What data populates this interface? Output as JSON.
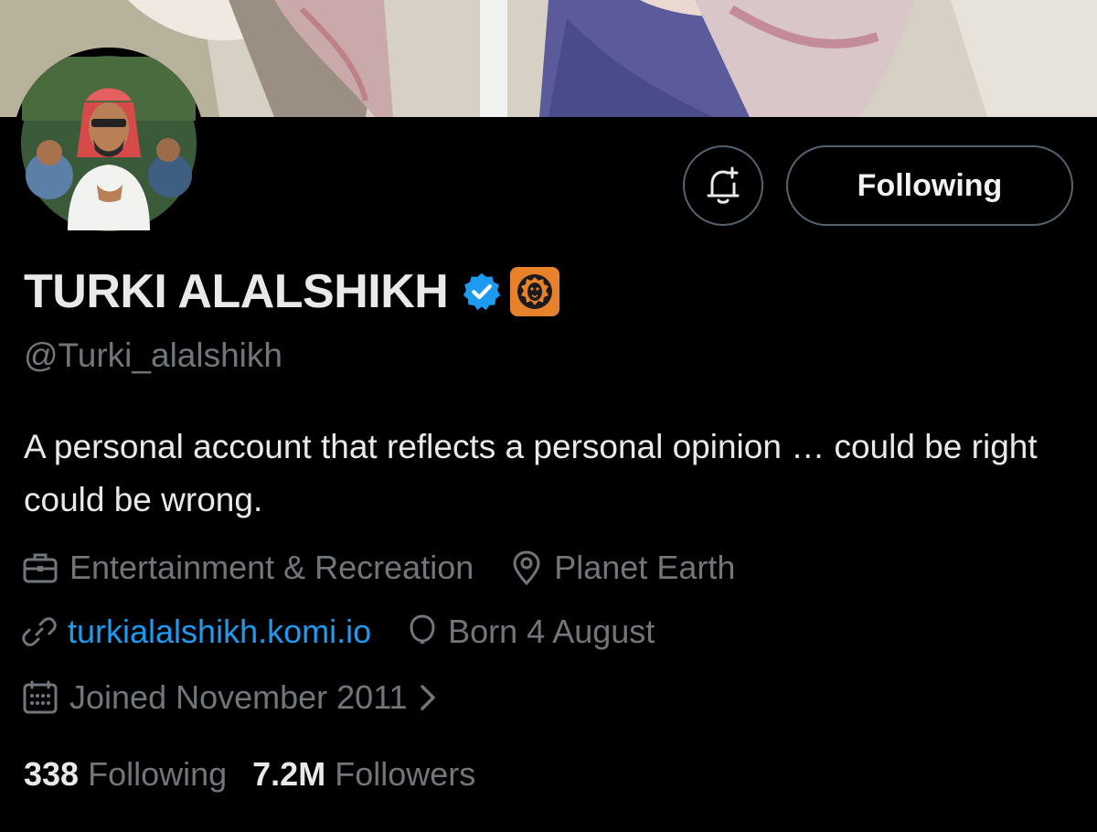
{
  "profile": {
    "display_name": "TURKI ALALSHIKH",
    "handle": "@Turki_alalshikh",
    "bio": "A personal account that reflects a personal opinion … could be right could be wrong.",
    "category": "Entertainment & Recreation",
    "location": "Planet Earth",
    "website": "turkialalshikh.komi.io",
    "birthday": "Born 4 August",
    "joined": "Joined November 2011",
    "following_count": "338",
    "following_label": "Following",
    "followers_count": "7.2M",
    "followers_label": "Followers"
  },
  "actions": {
    "follow_state_label": "Following"
  },
  "colors": {
    "background": "#000000",
    "primary_text": "#e7e9ea",
    "secondary_text": "#71767b",
    "link": "#1d9bf0",
    "verified_badge": "#1d9bf0",
    "affiliate_badge": "#e8822a",
    "button_border": "#536471"
  },
  "icons": {
    "verified": "verified-badge-icon",
    "affiliate": "lion-affiliate-icon",
    "notify": "bell-plus-icon",
    "category": "briefcase-icon",
    "location": "location-pin-icon",
    "website": "link-icon",
    "birthday": "balloon-icon",
    "joined": "calendar-icon",
    "joined_more": "chevron-right-icon"
  }
}
